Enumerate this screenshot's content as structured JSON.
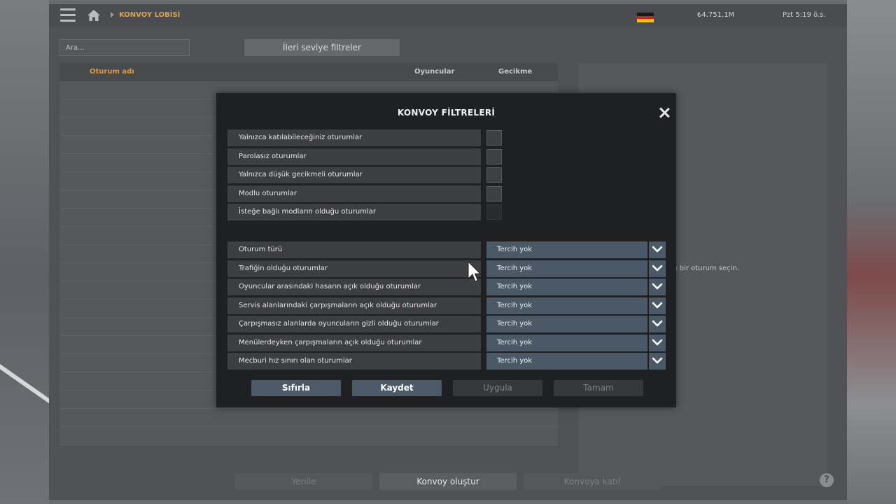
{
  "topbar": {
    "breadcrumb": "KONVOY LOBİSİ",
    "money": "₺4.751,1M",
    "clock": "Pzt 5:19 ö.s.",
    "flag_colors": [
      "#1a1a1a",
      "#d01f1f",
      "#f2c300"
    ]
  },
  "lobby": {
    "search_placeholder": "Ara...",
    "advanced_filters_label": "İleri seviye filtreler",
    "columns": {
      "name": "Oturum adı",
      "players": "Oyuncular",
      "ping": "Gecikme"
    },
    "right_panel_hint": "en bir oturum seçin.",
    "buttons": {
      "refresh": "Yenile",
      "create": "Konvoy oluştur",
      "join": "Konvoya katıl"
    }
  },
  "modal": {
    "title": "KONVOY FİLTRELERİ",
    "checkbox_options": [
      {
        "label": "Yalnızca katılabileceğiniz oturumlar",
        "checked": false,
        "enabled": true
      },
      {
        "label": "Parolasız oturumlar",
        "checked": false,
        "enabled": true
      },
      {
        "label": "Yalnızca düşük gecikmeli oturumlar",
        "checked": false,
        "enabled": true
      },
      {
        "label": "Modlu oturumlar",
        "checked": false,
        "enabled": true
      },
      {
        "label": "İsteğe bağlı modların olduğu oturumlar",
        "checked": false,
        "enabled": false
      }
    ],
    "select_options": [
      {
        "label": "Oturum türü",
        "value": "Tercih yok"
      },
      {
        "label": "Trafiğin olduğu oturumlar",
        "value": "Tercih yok"
      },
      {
        "label": "Oyuncular arasındaki hasarın açık olduğu oturumlar",
        "value": "Tercih yok"
      },
      {
        "label": "Servis alanlarındaki çarpışmaların açık olduğu oturumlar",
        "value": "Tercih yok"
      },
      {
        "label": "Çarpışmasız alanlarda oyuncuların gizli olduğu oturumlar",
        "value": "Tercih yok"
      },
      {
        "label": "Menülerdeyken çarpışmaların açık olduğu oturumlar",
        "value": "Tercih yok"
      },
      {
        "label": "Mecburi hız sınırı olan oturumlar",
        "value": "Tercih yok"
      }
    ],
    "buttons": {
      "reset": "Sıfırla",
      "save": "Kaydet",
      "apply": "Uygula",
      "ok": "Tamam"
    }
  }
}
